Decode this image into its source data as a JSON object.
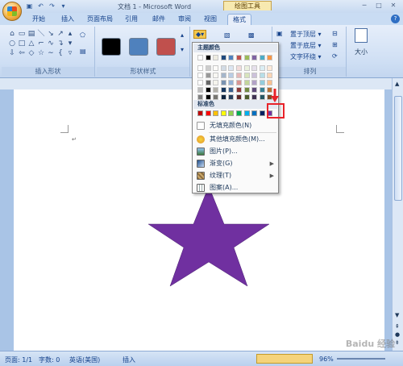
{
  "window": {
    "title": "文档 1 - Microsoft Word",
    "context_tab_group": "绘图工具"
  },
  "tabs": [
    {
      "label": "开始"
    },
    {
      "label": "插入"
    },
    {
      "label": "页面布局"
    },
    {
      "label": "引用"
    },
    {
      "label": "邮件"
    },
    {
      "label": "审阅"
    },
    {
      "label": "视图"
    },
    {
      "label": "格式"
    }
  ],
  "ribbon": {
    "groups": {
      "insert_shapes": "插入形状",
      "shape_styles": "形状样式",
      "arrange": "排列"
    },
    "arrange_buttons": {
      "bring_to_front": "置于顶层",
      "send_to_back": "置于底层",
      "text_wrap": "文字环绕"
    },
    "size_label": "大小",
    "style_swatch_colors": [
      "#000000",
      "#4f81bd",
      "#c0504d"
    ]
  },
  "fill_dropdown": {
    "theme_colors_header": "主题颜色",
    "standard_colors_header": "标准色",
    "theme_top_row": [
      "#ffffff",
      "#000000",
      "#eeece1",
      "#1f497d",
      "#4f81bd",
      "#c0504d",
      "#9bbb59",
      "#8064a2",
      "#4bacc6",
      "#f79646"
    ],
    "standard_colors": [
      "#c00000",
      "#ff0000",
      "#ffc000",
      "#ffff00",
      "#92d050",
      "#00b050",
      "#00b0f0",
      "#0070c0",
      "#002060",
      "#7030a0"
    ],
    "menu_items": [
      {
        "label": "无填充颜色(N)",
        "icon": "no-fill-icon"
      },
      {
        "label": "其他填充颜色(M)...",
        "icon": "palette-icon"
      },
      {
        "label": "图片(P)...",
        "icon": "picture-icon"
      },
      {
        "label": "渐变(G)",
        "icon": "gradient-icon",
        "submenu": true
      },
      {
        "label": "纹理(T)",
        "icon": "texture-icon",
        "submenu": true
      },
      {
        "label": "图案(A)...",
        "icon": "pattern-icon"
      }
    ]
  },
  "document": {
    "star_color": "#7030a0"
  },
  "statusbar": {
    "page": "页面: 1/1",
    "words": "字数: 0",
    "language": "英语(美国)",
    "mode": "插入",
    "zoom": "96%"
  },
  "watermark": "Baidu 经验"
}
